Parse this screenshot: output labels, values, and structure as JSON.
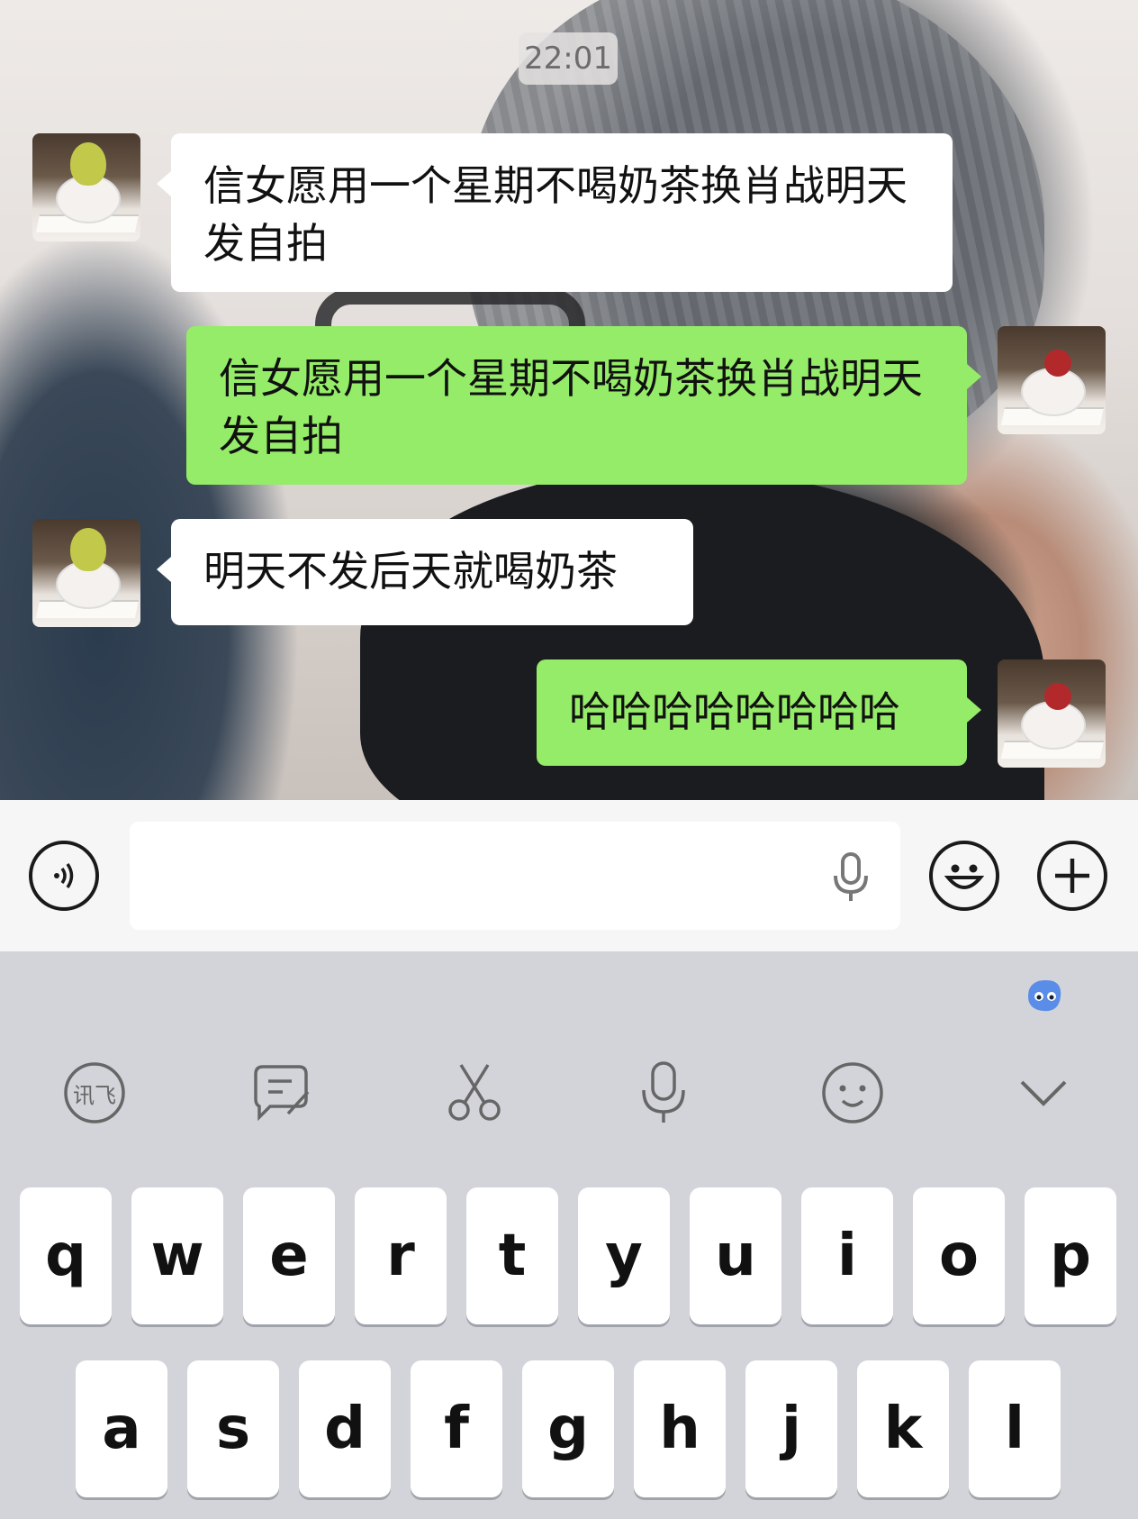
{
  "chat": {
    "timestamp": "22:01",
    "messages": [
      {
        "side": "left",
        "avatar": "pear-bunny-avatar",
        "text": "信女愿用一个星期不喝奶茶换肖战明天发自拍"
      },
      {
        "side": "right",
        "avatar": "apple-bunny-avatar",
        "text": "信女愿用一个星期不喝奶茶换肖战明天发自拍"
      },
      {
        "side": "left",
        "avatar": "pear-bunny-avatar",
        "text": "明天不发后天就喝奶茶"
      },
      {
        "side": "right",
        "avatar": "apple-bunny-avatar",
        "text": "哈哈哈哈哈哈哈哈"
      }
    ]
  },
  "input_bar": {
    "icons": [
      "voice-icon",
      "mic-icon",
      "emoji-icon",
      "plus-icon"
    ],
    "text_value": ""
  },
  "keyboard": {
    "toolbar_icons": [
      "ifly-icon",
      "handwriting-icon",
      "scissors-icon",
      "mic-icon",
      "smiley-icon",
      "chevron-down-icon"
    ],
    "toolbar_labels": {
      "ifly": "讯飞"
    },
    "row1": [
      "q",
      "w",
      "e",
      "r",
      "t",
      "y",
      "u",
      "i",
      "o",
      "p"
    ],
    "row2": [
      "a",
      "s",
      "d",
      "f",
      "g",
      "h",
      "j",
      "k",
      "l"
    ],
    "colors": {
      "keyboard_bg": "#d2d4da",
      "key_bg": "#ffffff",
      "bubble_sent": "#95ec69",
      "bubble_received": "#ffffff"
    }
  }
}
